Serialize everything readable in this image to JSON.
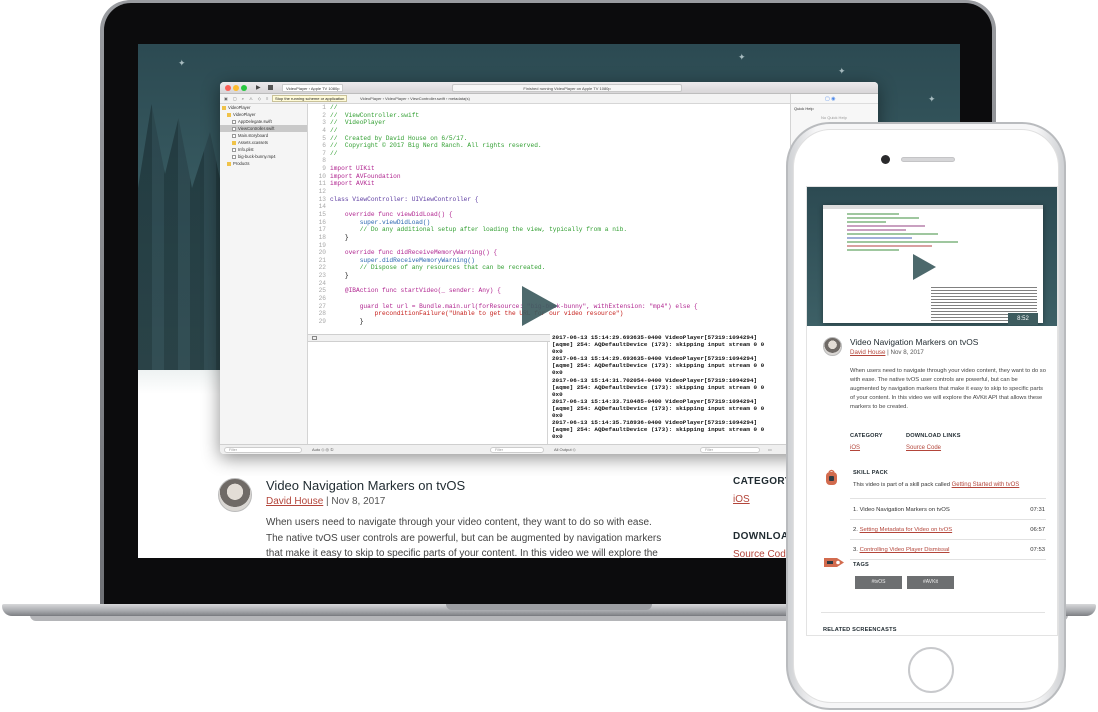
{
  "xcode": {
    "scheme": "VideoPlayer  ›  Apple TV 1080p",
    "status": "Finished running VideoPlayer on Apple TV 1080p",
    "tooltip": "Stop the running scheme or application",
    "path": "VideoPlayer  ›  VideoPlayer  ›  ViewController.swift  ›  metadata(s)",
    "inspector_title": "Quick Help",
    "inspector_note": "No Quick Help",
    "navigator": [
      {
        "label": "VideoPlayer",
        "kind": "folder",
        "indent": 0
      },
      {
        "label": "VideoPlayer",
        "kind": "folder",
        "indent": 1
      },
      {
        "label": "AppDelegate.swift",
        "kind": "file",
        "indent": 2
      },
      {
        "label": "ViewController.swift",
        "kind": "file",
        "indent": 2,
        "selected": true
      },
      {
        "label": "Main.storyboard",
        "kind": "file",
        "indent": 2
      },
      {
        "label": "Assets.xcassets",
        "kind": "folder",
        "indent": 2
      },
      {
        "label": "Info.plist",
        "kind": "file",
        "indent": 2
      },
      {
        "label": "big-buck-bunny.mp4",
        "kind": "file",
        "indent": 2
      },
      {
        "label": "Products",
        "kind": "folder",
        "indent": 1
      }
    ],
    "code_lines": [
      {
        "n": "1",
        "t": "//",
        "c": "c-com"
      },
      {
        "n": "2",
        "t": "//  ViewController.swift",
        "c": "c-com"
      },
      {
        "n": "3",
        "t": "//  VideoPlayer",
        "c": "c-com"
      },
      {
        "n": "4",
        "t": "//",
        "c": "c-com"
      },
      {
        "n": "5",
        "t": "//  Created by David House on 6/5/17.",
        "c": "c-com"
      },
      {
        "n": "6",
        "t": "//  Copyright © 2017 Big Nerd Ranch. All rights reserved.",
        "c": "c-com"
      },
      {
        "n": "7",
        "t": "//",
        "c": "c-com"
      },
      {
        "n": "8",
        "t": "",
        "c": "c-pl"
      },
      {
        "n": "9",
        "t": "import UIKit",
        "c": "c-kw"
      },
      {
        "n": "10",
        "t": "import AVFoundation",
        "c": "c-kw"
      },
      {
        "n": "11",
        "t": "import AVKit",
        "c": "c-kw"
      },
      {
        "n": "12",
        "t": "",
        "c": "c-pl"
      },
      {
        "n": "13",
        "t": "class ViewController: UIViewController {",
        "c": "c-typ"
      },
      {
        "n": "14",
        "t": "",
        "c": "c-pl"
      },
      {
        "n": "15",
        "t": "    override func viewDidLoad() {",
        "c": "c-kw"
      },
      {
        "n": "16",
        "t": "        super.viewDidLoad()",
        "c": "c-fn"
      },
      {
        "n": "17",
        "t": "        // Do any additional setup after loading the view, typically from a nib.",
        "c": "c-com"
      },
      {
        "n": "18",
        "t": "    }",
        "c": "c-pl"
      },
      {
        "n": "19",
        "t": "",
        "c": "c-pl"
      },
      {
        "n": "20",
        "t": "    override func didReceiveMemoryWarning() {",
        "c": "c-kw"
      },
      {
        "n": "21",
        "t": "        super.didReceiveMemoryWarning()",
        "c": "c-fn"
      },
      {
        "n": "22",
        "t": "        // Dispose of any resources that can be recreated.",
        "c": "c-com"
      },
      {
        "n": "23",
        "t": "    }",
        "c": "c-pl"
      },
      {
        "n": "24",
        "t": "",
        "c": "c-pl"
      },
      {
        "n": "25",
        "t": "    @IBAction func startVideo(_ sender: Any) {",
        "c": "c-kw"
      },
      {
        "n": "26",
        "t": "",
        "c": "c-pl"
      },
      {
        "n": "27",
        "t": "        guard let url = Bundle.main.url(forResource: \"big-buck-bunny\", withExtension: \"mp4\") else {",
        "c": "c-kw"
      },
      {
        "n": "28",
        "t": "            preconditionFailure(\"Unable to get the URL for our video resource\")",
        "c": "c-str"
      },
      {
        "n": "29",
        "t": "        }",
        "c": "c-pl"
      }
    ],
    "console_lines": [
      "2017-06-13 15:14:29.693635-0400 VideoPlayer[57319:1094294]",
      "[aqme] 254: AQDefaultDevice (173): skipping input stream 0 0",
      "0x0",
      "2017-06-13 15:14:29.693635-0400 VideoPlayer[57319:1094294]",
      "[aqme] 254: AQDefaultDevice (173): skipping input stream 0 0",
      "0x0",
      "2017-06-13 15:14:31.702054-0400 VideoPlayer[57319:1094294]",
      "[aqme] 254: AQDefaultDevice (173): skipping input stream 0 0",
      "0x0",
      "2017-06-13 15:14:33.710485-0400 VideoPlayer[57319:1094294]",
      "[aqme] 254: AQDefaultDevice (173): skipping input stream 0 0",
      "0x0",
      "2017-06-13 15:14:35.718936-0400 VideoPlayer[57319:1094294]",
      "[aqme] 254: AQDefaultDevice (173): skipping input stream 0 0",
      "0x0"
    ],
    "bottom_left": "Auto ◇  ◎ ①",
    "filter_placeholder": "Filter",
    "output_label": "All Output ◇"
  },
  "article": {
    "title": "Video Navigation Markers on tvOS",
    "author": "David House",
    "date": "| Nov 8, 2017",
    "body": "When users need to navigate through your video content, they want to do so with ease. The native tvOS user controls are powerful, but can be augmented by navigation markers that make it easy to skip to specific parts of your content. In this video we will explore the AVKit",
    "category_heading": "CATEGORY",
    "category": "iOS",
    "download_heading": "DOWNLOAD LINKS",
    "download": "Source Code"
  },
  "mobile": {
    "duration": "8:52",
    "title": "Video Navigation Markers on tvOS",
    "author": "David House",
    "date": "| Nov 8, 2017",
    "body": "When users need to navigate through your video content, they want to do so with ease. The native tvOS user controls are powerful, but can be augmented by navigation markers that make it easy to skip to specific parts of your content. In this video we will explore the AVKit API that allows these markers to be created.",
    "category_heading": "CATEGORY",
    "category": "iOS",
    "download_heading": "DOWNLOAD LINKS",
    "download": "Source Code",
    "skill_pack_heading": "SKILL PACK",
    "skill_pack_text": "This video is part of a skill pack called",
    "skill_pack_link": "Getting Started with tvOS",
    "lessons": [
      {
        "num": "1.",
        "title": "Video Navigation Markers on tvOS",
        "duration": "07:31",
        "link": false
      },
      {
        "num": "2.",
        "title": "Setting Metadata for Video on tvOS",
        "duration": "06:57",
        "link": true
      },
      {
        "num": "3.",
        "title": "Controlling Video Player Dismissal",
        "duration": "07:53",
        "link": true
      }
    ],
    "tags_heading": "TAGS",
    "tags": [
      "#tvOS",
      "#AVKit"
    ],
    "related_heading": "RELATED SCREENCASTS"
  },
  "colors": {
    "accent": "#b3453a",
    "hero": "#2c4a52",
    "play": "#3e5c5f"
  }
}
